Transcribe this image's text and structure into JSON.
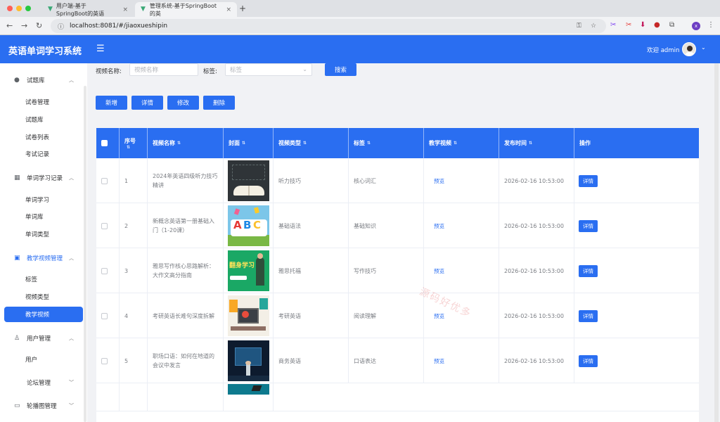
{
  "browser": {
    "tabs": [
      {
        "title": "用户端-基于SpringBoot的英语"
      },
      {
        "title": "管理系统-基于SpringBoot的英"
      }
    ],
    "url": "localhost:8081/#/jiaoxueshipin"
  },
  "header": {
    "title": "英语单词学习系统",
    "welcome": "欢迎 admin"
  },
  "sidebar": {
    "groups": [
      {
        "label": "试题库",
        "items": [
          "试卷管理",
          "试题库",
          "试卷列表",
          "考试记录"
        ]
      },
      {
        "label": "单词学习记录",
        "items": [
          "单词学习",
          "单词库",
          "单词类型"
        ]
      },
      {
        "label": "教学视频管理",
        "items": [
          "标签",
          "视频类型",
          "教学视频"
        ]
      },
      {
        "label": "用户管理",
        "items": [
          "用户"
        ]
      },
      {
        "label": "论坛管理",
        "items": []
      },
      {
        "label": "轮播图管理",
        "items": []
      }
    ]
  },
  "search": {
    "name_label": "视频名称:",
    "name_placeholder": "视频名称",
    "tag_label": "标签:",
    "tag_placeholder": "标签",
    "search_button": "搜索"
  },
  "actions": {
    "add": "新增",
    "detail": "详情",
    "edit": "修改",
    "delete": "删除"
  },
  "table": {
    "columns": [
      "序号",
      "视频名称",
      "封面",
      "视频类型",
      "标签",
      "教学视频",
      "发布时间",
      "操作"
    ],
    "rows": [
      {
        "index": "1",
        "name": "2024年英语四级听力技巧精讲",
        "type": "听力技巧",
        "tag": "核心词汇",
        "video": "预览",
        "time": "2026-02-16 10:53:00",
        "op": "详情"
      },
      {
        "index": "2",
        "name": "新概念英语第一册基础入门（1-20课）",
        "type": "基础语法",
        "tag": "基础知识",
        "video": "预览",
        "time": "2026-02-16 10:53:00",
        "op": "详情"
      },
      {
        "index": "3",
        "name": "雅思写作核心思路解析：大作文高分指南",
        "type": "雅思托福",
        "tag": "写作技巧",
        "video": "预览",
        "time": "2026-02-16 10:53:00",
        "op": "详情"
      },
      {
        "index": "4",
        "name": "考研英语长难句深度拆解",
        "type": "考研英语",
        "tag": "阅读理解",
        "video": "预览",
        "time": "2026-02-16 10:53:00",
        "op": "详情"
      },
      {
        "index": "5",
        "name": "职场口语：如何在地道的会议中发言",
        "type": "商务英语",
        "tag": "口语表达",
        "video": "预览",
        "time": "2026-02-16 10:53:00",
        "op": "详情"
      }
    ],
    "cover_text_3": "翻身学习"
  },
  "watermark": "源码好优多",
  "colors": {
    "primary": "#2a6ef1",
    "background": "#f1f2f5"
  }
}
